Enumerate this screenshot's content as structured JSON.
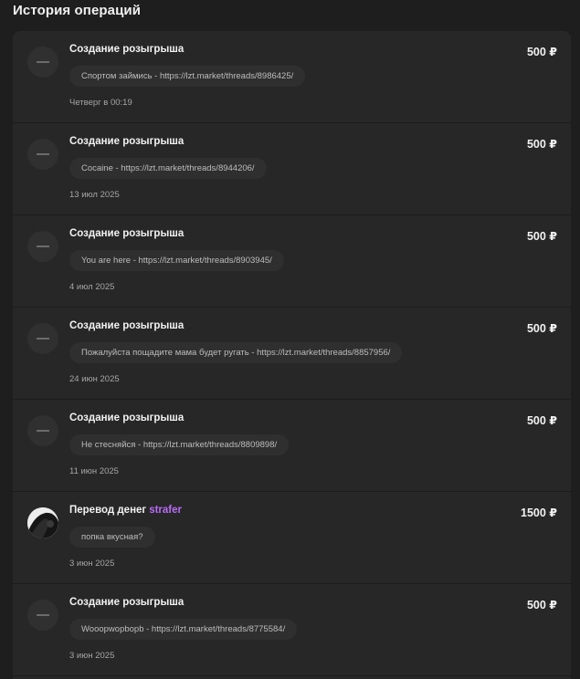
{
  "page": {
    "title": "История операций"
  },
  "operations": [
    {
      "type": "giveaway",
      "title": "Создание розыгрыша",
      "amount": "500 ₽",
      "comment": "Спортом займись - https://lzt.market/threads/8986425/",
      "date": "Четверг в 00:19"
    },
    {
      "type": "giveaway",
      "title": "Создание розыгрыша",
      "amount": "500 ₽",
      "comment": "Cocaine - https://lzt.market/threads/8944206/",
      "date": "13 июл 2025"
    },
    {
      "type": "giveaway",
      "title": "Создание розыгрыша",
      "amount": "500 ₽",
      "comment": "You are here - https://lzt.market/threads/8903945/",
      "date": "4 июл 2025"
    },
    {
      "type": "giveaway",
      "title": "Создание розыгрыша",
      "amount": "500 ₽",
      "comment": "Пожалуйста пощадите мама будет ругать - https://lzt.market/threads/8857956/",
      "date": "24 июн 2025"
    },
    {
      "type": "giveaway",
      "title": "Создание розыгрыша",
      "amount": "500 ₽",
      "comment": "Не стесняйся - https://lzt.market/threads/8809898/",
      "date": "11 июн 2025"
    },
    {
      "type": "transfer",
      "title": "Перевод денег",
      "user": "strafer",
      "amount": "1500 ₽",
      "comment": "попка вкусная?",
      "date": "3 июн 2025"
    },
    {
      "type": "giveaway",
      "title": "Создание розыгрыша",
      "amount": "500 ₽",
      "comment": "Wooopwopbopb - https://lzt.market/threads/8775584/",
      "date": "3 июн 2025"
    }
  ],
  "colors": {
    "accent_user": "#b86cf5",
    "panel_bg": "#272727",
    "page_bg": "#1e1e1e"
  }
}
